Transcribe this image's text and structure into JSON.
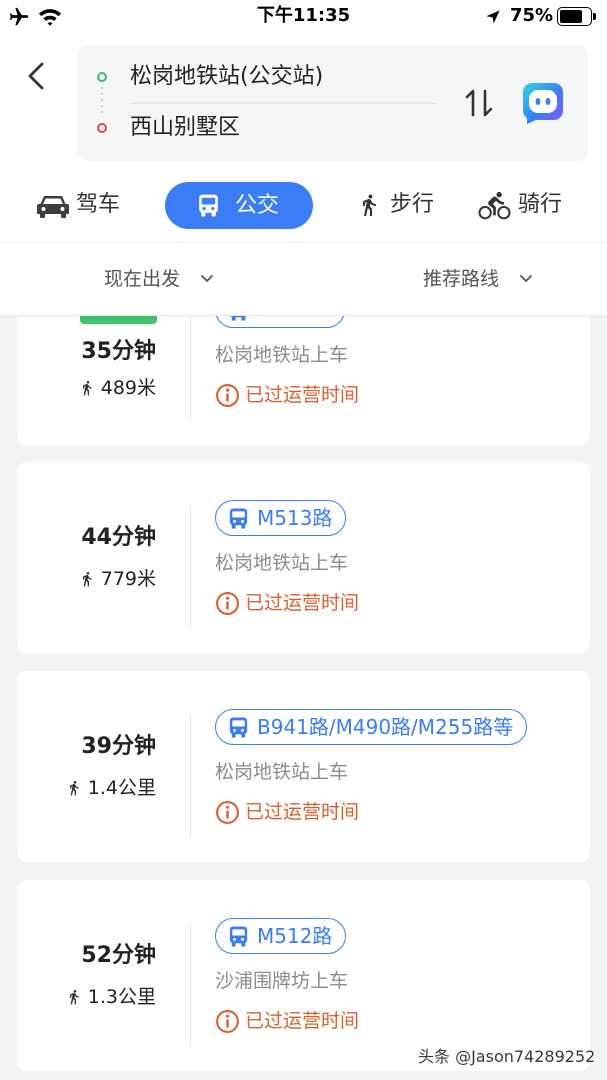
{
  "status_bar": {
    "time": "下午11:35",
    "battery_text": "75%",
    "battery_level": 0.75,
    "icons": [
      "airplane-icon",
      "wifi-icon",
      "location-arrow-icon",
      "battery-icon"
    ]
  },
  "route": {
    "origin": "松岗地铁站(公交站)",
    "destination": "西山别墅区",
    "icons": {
      "back": "back-chevron-icon",
      "swap": "swap-icon",
      "assistant": "assistant-app-icon"
    }
  },
  "tabs": [
    {
      "label": "驾车",
      "icon": "car-icon",
      "selected": false
    },
    {
      "label": "公交",
      "icon": "bus-icon",
      "selected": true
    },
    {
      "label": "步行",
      "icon": "walk-icon",
      "selected": false
    },
    {
      "label": "骑行",
      "icon": "bike-icon",
      "selected": false
    }
  ],
  "filters": {
    "departure": "现在出发",
    "sort": "推荐路线"
  },
  "results": [
    {
      "duration": "35分钟",
      "walk_distance": "489米",
      "boarding_stop": "松岗地铁站上车",
      "status": "已过运营时间"
    },
    {
      "duration": "44分钟",
      "walk_distance": "779米",
      "lines": "M513路",
      "boarding_stop": "松岗地铁站上车",
      "status": "已过运营时间"
    },
    {
      "duration": "39分钟",
      "walk_distance": "1.4公里",
      "lines": "B941路/M490路/M255路等",
      "boarding_stop": "松岗地铁站上车",
      "status": "已过运营时间"
    },
    {
      "duration": "52分钟",
      "walk_distance": "1.3公里",
      "lines": "M512路",
      "boarding_stop": "沙浦围牌坊上车",
      "status": "已过运营时间"
    }
  ],
  "watermark": "头条 @Jason74289252",
  "colors": {
    "accent": "#3b7df7",
    "origin_dot": "#3dbb6c",
    "destination_dot": "#e0474c",
    "warning": "#d9602e",
    "badge": "#3fc46e",
    "page_bg": "#f2f3f5"
  }
}
